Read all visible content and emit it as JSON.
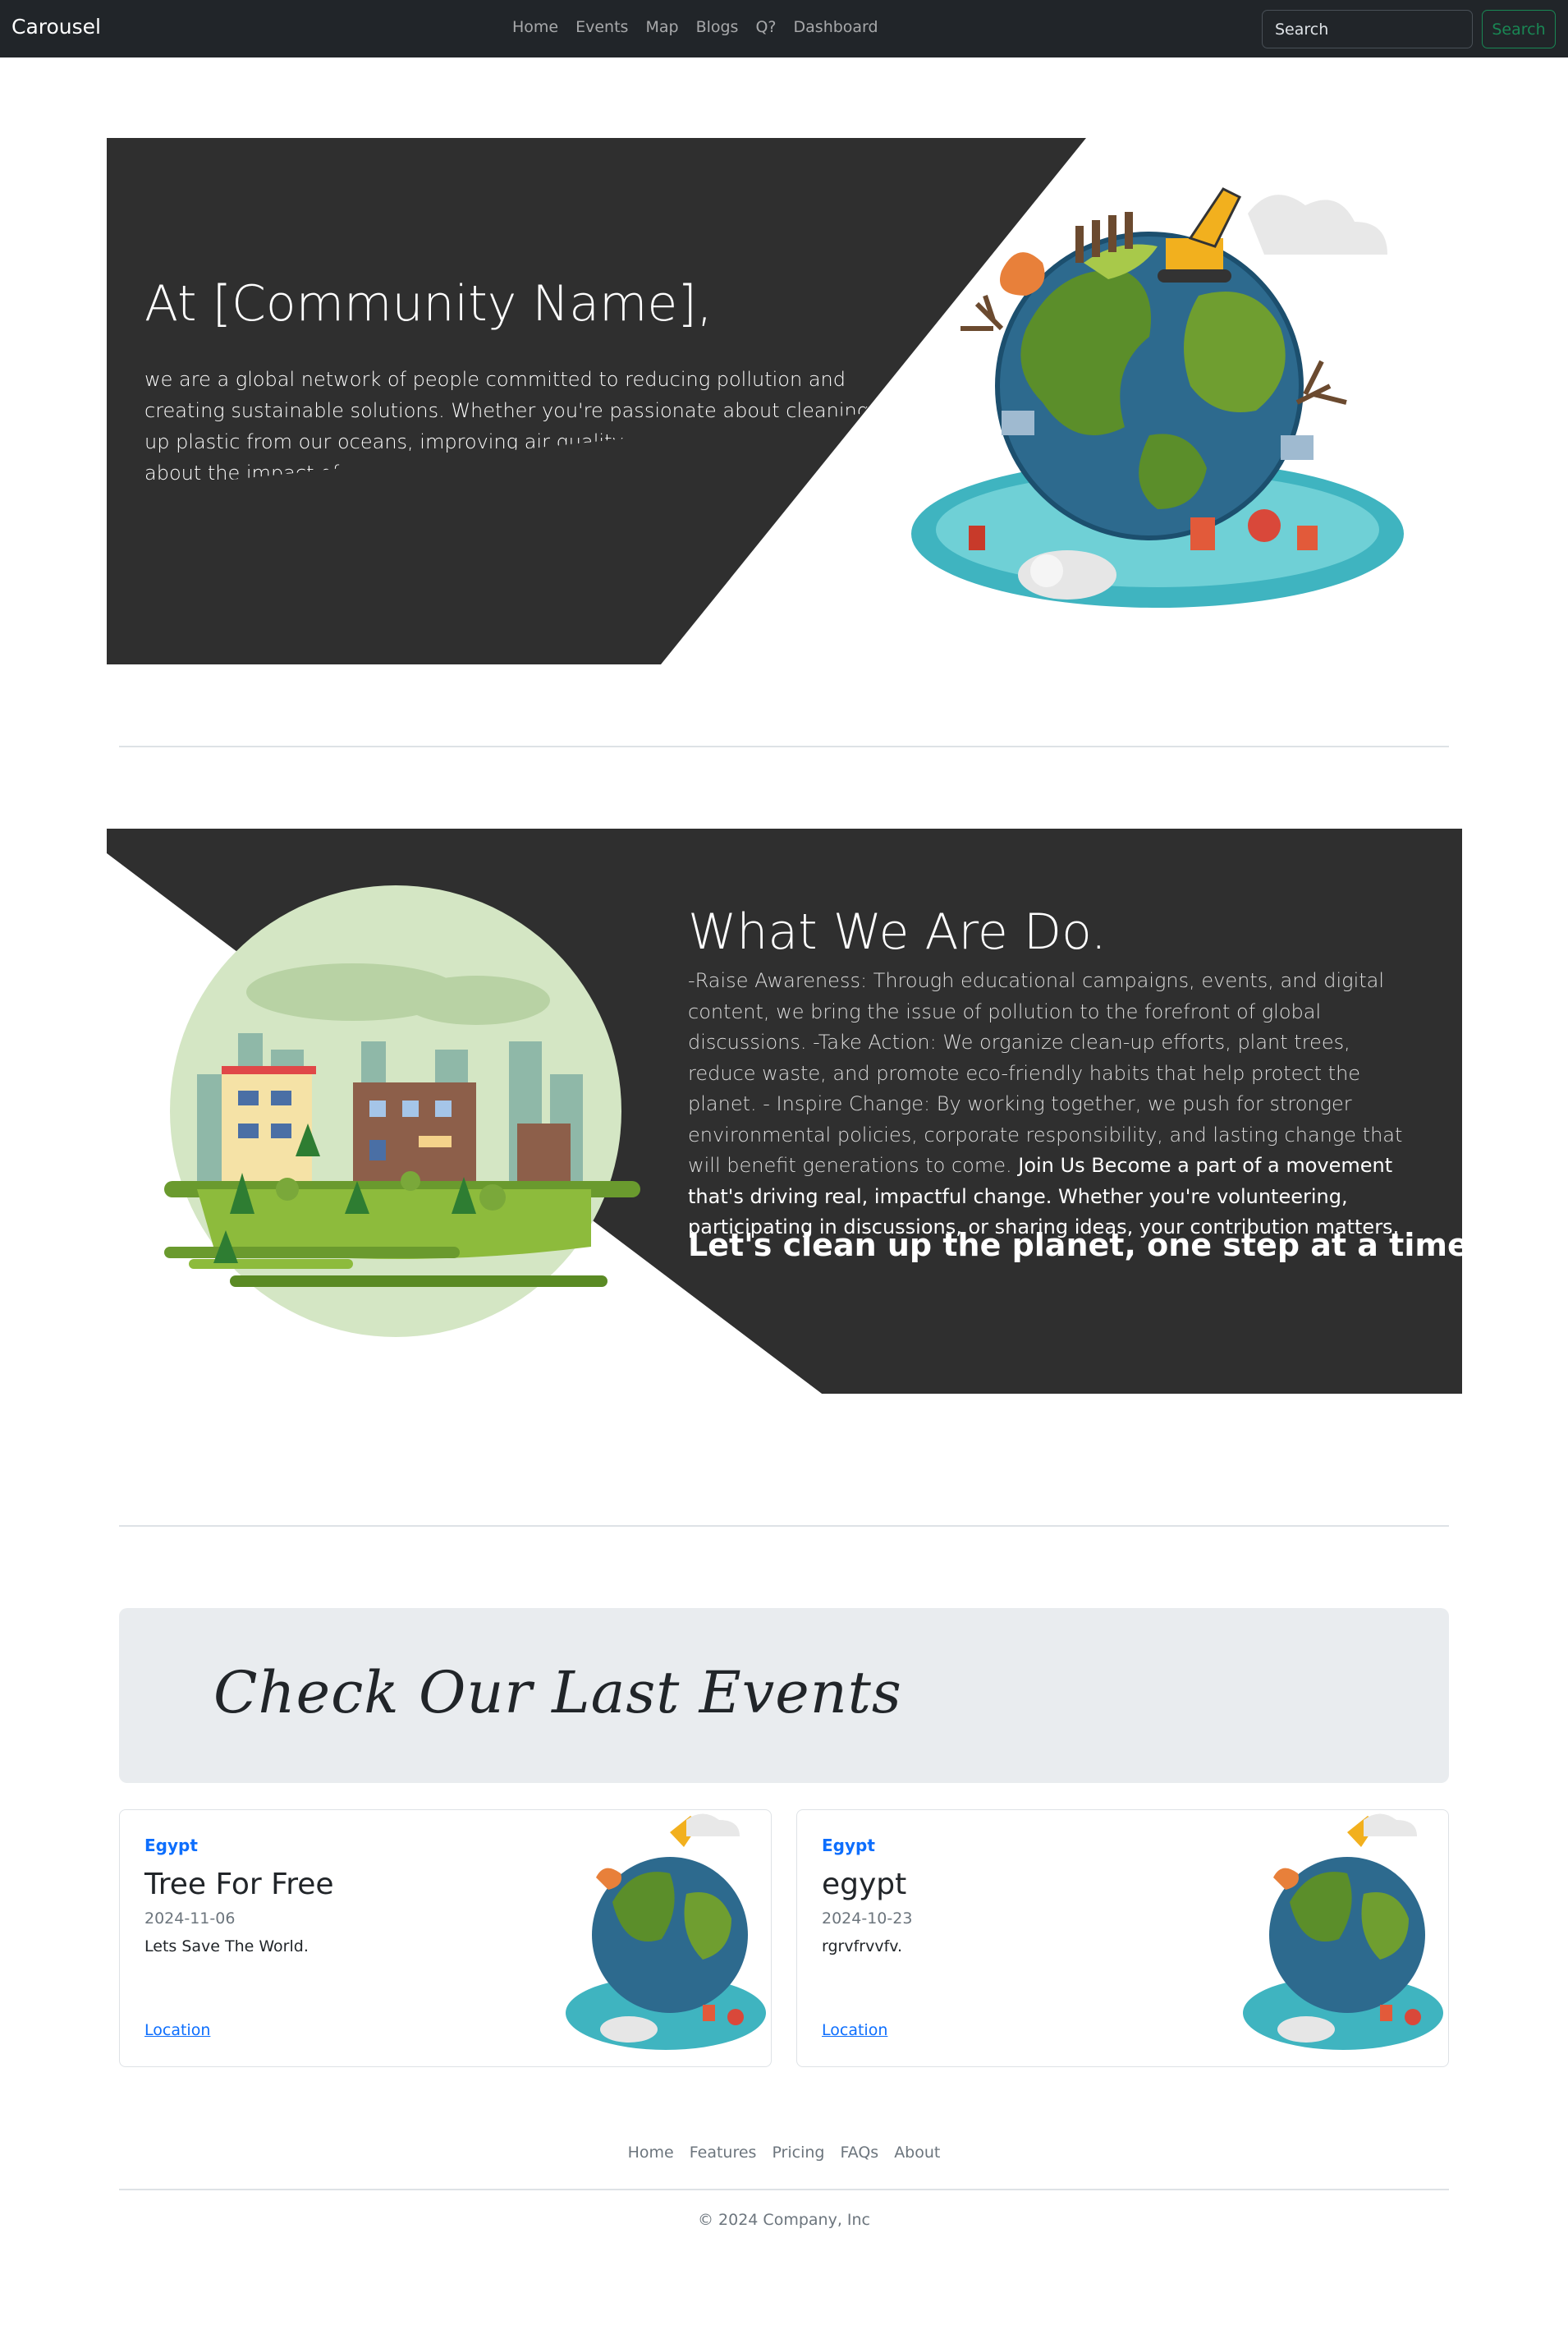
{
  "navbar": {
    "brand": "Carousel",
    "links": [
      "Home",
      "Events",
      "Map",
      "Blogs",
      "Q?",
      "Dashboard"
    ],
    "search_placeholder": "Search",
    "search_button": "Search"
  },
  "hero1": {
    "title": "At [Community Name],",
    "body": "we are a global network of people committed to reducing pollution and creating sustainable solutions. Whether you're passionate about cleaning up plastic from our oceans, improving air quality, or raising awareness about the impact of waste on our communities, there's a place for you here."
  },
  "hero2": {
    "title": "What We Are Do.",
    "body": "-Raise Awareness: Through educational campaigns, events, and digital content, we bring the issue of pollution to the forefront of global discussions. -Take Action: We organize clean-up efforts, plant trees, reduce waste, and promote eco-friendly habits that help protect the planet. - Inspire Change: By working together, we push for stronger environmental policies, corporate responsibility, and lasting change that will benefit generations to come.",
    "body_strong": "Join Us Become a part of a movement that's driving real, impactful change. Whether you're volunteering, participating in discussions, or sharing ideas, your contribution matters.",
    "tagline": "Let's clean up the planet, one step at a time."
  },
  "events": {
    "heading": "Check Our Last Events",
    "cards": [
      {
        "country": "Egypt",
        "title": "Tree For Free",
        "date": "2024-11-06",
        "description": "Lets Save The World.",
        "link": "Location"
      },
      {
        "country": "Egypt",
        "title": "egypt",
        "date": "2024-10-23",
        "description": "rgrvfrvvfv.",
        "link": "Location"
      }
    ]
  },
  "footer": {
    "links": [
      "Home",
      "Features",
      "Pricing",
      "FAQs",
      "About"
    ],
    "copyright": "© 2024 Company, Inc"
  },
  "colors": {
    "navbar_bg": "#212529",
    "hero_bg": "#2f2f2f",
    "accent_green": "#198754",
    "link_blue": "#0d6efd",
    "banner_bg": "#e9ecef"
  }
}
